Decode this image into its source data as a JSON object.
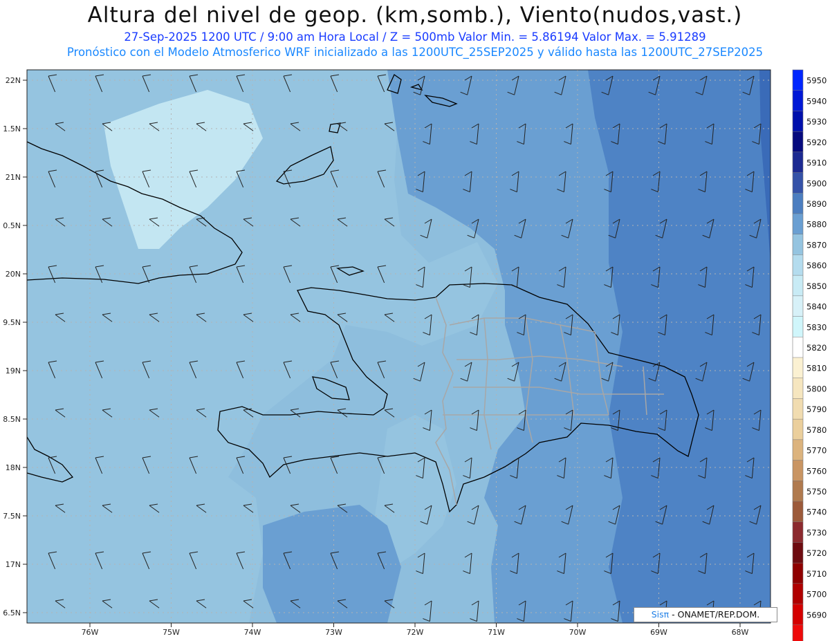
{
  "header": {
    "title": "Altura del nivel de geop. (km,somb.), Viento(nudos,vast.)",
    "subtitle_1": "27-Sep-2025  1200 UTC / 9:00 am Hora Local / Z = 500mb     Valor Min. = 5.86194  Valor Max. = 5.91289",
    "subtitle_2": "Pronóstico con el Modelo Atmosferico WRF inicializado a las 1200UTC_25SEP2025 y válido hasta las  1200UTC_27SEP2025"
  },
  "map": {
    "lat_labels": [
      "22N",
      "1.5N",
      "21N",
      "0.5N",
      "20N",
      "9.5N",
      "19N",
      "8.5N",
      "18N",
      "7.5N",
      "17N",
      "6.5N"
    ],
    "lon_labels": [
      "76W",
      "75W",
      "74W",
      "73W",
      "72W",
      "71W",
      "70W",
      "69W",
      "68W"
    ],
    "shading_colors": [
      "#95c4e0",
      "#6a9fd2",
      "#4e83c5",
      "#3a6bb8",
      "#c3e6f2"
    ]
  },
  "colorbar": {
    "labels": [
      "5950",
      "5940",
      "5930",
      "5920",
      "5910",
      "5900",
      "5890",
      "5880",
      "5870",
      "5860",
      "5850",
      "5840",
      "5830",
      "5820",
      "5810",
      "5800",
      "5790",
      "5780",
      "5770",
      "5760",
      "5750",
      "5740",
      "5730",
      "5720",
      "5710",
      "5700",
      "5690"
    ],
    "colors": [
      "#0026ff",
      "#0018d6",
      "#0010ac",
      "#060a7e",
      "#1c2a92",
      "#3552a8",
      "#4c7ec0",
      "#6a9fd2",
      "#95c4e0",
      "#b4dcee",
      "#c8ebf5",
      "#d7f1f8",
      "#d0f6fb",
      "#ffffff",
      "#fbf1d2",
      "#f6e6bf",
      "#f1dcb0",
      "#ebcf9c",
      "#dcb37d",
      "#c99563",
      "#b07a4e",
      "#9c5a3a",
      "#8c2a2e",
      "#6e0b10",
      "#8f0000",
      "#b00000",
      "#d40000",
      "#ee0a0a"
    ]
  },
  "footer": {
    "logo": "Sisπ",
    "credit": " - ONAMET/REP.DOM."
  }
}
